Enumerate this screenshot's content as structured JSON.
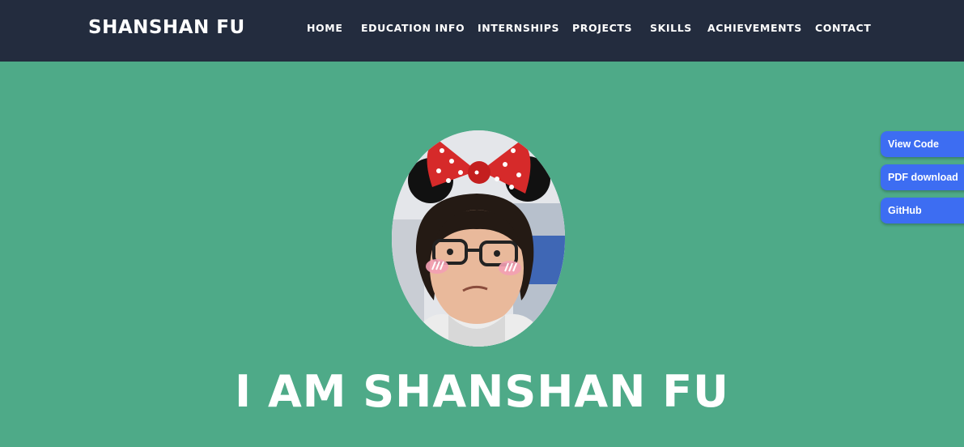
{
  "brand": {
    "name": "SHANSHAN FU"
  },
  "nav": {
    "items": [
      "HOME",
      "EDUCATION INFO",
      "INTERNSHIPS",
      "PROJECTS",
      "SKILLS",
      "ACHIEVEMENTS",
      "CONTACT"
    ]
  },
  "hero": {
    "headline": "I AM SHANSHAN FU"
  },
  "side_buttons": {
    "view_code": "View Code",
    "pdf_download": "PDF download",
    "github": "GitHub"
  },
  "colors": {
    "navbar_bg": "#232c3e",
    "hero_bg": "#4eaa88",
    "side_button_bg": "#3d6df2",
    "text": "#ffffff"
  }
}
